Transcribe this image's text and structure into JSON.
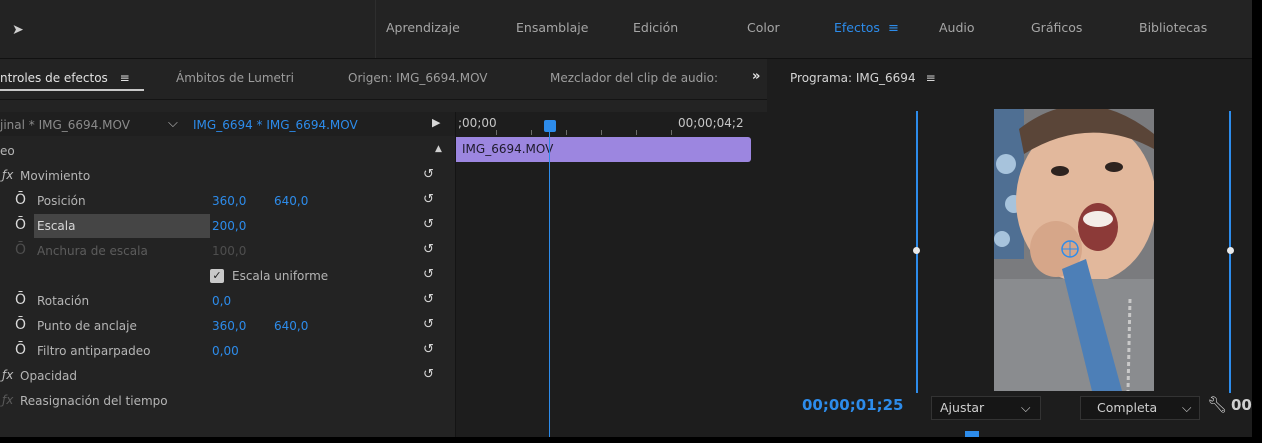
{
  "workspaces": [
    {
      "label": "Aprendizaje"
    },
    {
      "label": "Ensamblaje"
    },
    {
      "label": "Edición"
    },
    {
      "label": "Color"
    },
    {
      "label": "Efectos",
      "active": true
    },
    {
      "label": "Audio"
    },
    {
      "label": "Gráficos"
    },
    {
      "label": "Bibliotecas"
    }
  ],
  "menu_glyph": "≡",
  "panel_tabs": [
    {
      "label": "ntroles de efectos",
      "active": true
    },
    {
      "label": "Ámbitos de Lumetri"
    },
    {
      "label": "Origen: IMG_6694.MOV"
    },
    {
      "label": "Mezclador del clip de audio:"
    }
  ],
  "overflow_glyph": "»",
  "source": {
    "master": "jinal * IMG_6694.MOV",
    "dropdown_glyph": "⌵",
    "sequence_clip": "IMG_6694 * IMG_6694.MOV"
  },
  "sections": {
    "video": "eo",
    "motion": "Movimiento",
    "opacity": "Opacidad",
    "time_remap": "Reasignación del tiempo"
  },
  "properties": {
    "position": {
      "label": "Posición",
      "x": "360,0",
      "y": "640,0"
    },
    "scale": {
      "label": "Escala",
      "value": "200,0"
    },
    "scale_width": {
      "label": "Anchura de escala",
      "value": "100,0"
    },
    "uniform_scale": {
      "label": "Escala uniforme",
      "checked": true
    },
    "rotation": {
      "label": "Rotación",
      "value": "0,0"
    },
    "anchor_point": {
      "label": "Punto de anclaje",
      "x": "360,0",
      "y": "640,0"
    },
    "anti_flicker": {
      "label": "Filtro antiparpadeo",
      "value": "0,00"
    }
  },
  "timeline": {
    "start_tc": ";00;00",
    "end_tc": "00;00;04;2",
    "clip_name": "IMG_6694.MOV"
  },
  "program": {
    "title": "Programa: IMG_6694",
    "timecode": "00;00;01;25",
    "fit_label": "Ajustar",
    "quality_label": "Completa",
    "duration_partial": "00;"
  },
  "colors": {
    "accent": "#2d8ceb",
    "clip": "#9c86e0"
  }
}
